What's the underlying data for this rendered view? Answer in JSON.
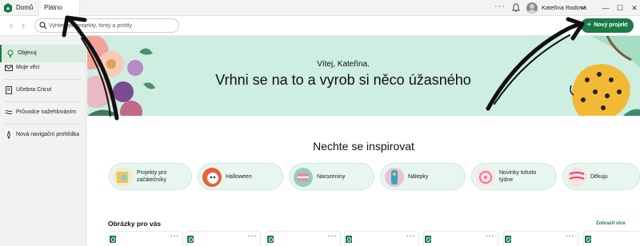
{
  "titlebar": {
    "tabs": [
      {
        "label": "Domů"
      },
      {
        "label": "Plátno"
      }
    ],
    "more_label": "···",
    "user_name": "Kateřina Rodová",
    "window_controls": {
      "minimize": "—",
      "maximize": "☐",
      "close": "✕"
    }
  },
  "toolbar": {
    "search_placeholder": "Vyhledejte projekty, fonty a profily",
    "new_project_label": "Nový projekt",
    "new_project_plus": "+"
  },
  "sidebar": {
    "items": [
      {
        "label": "Objevuj",
        "icon": "lightbulb-icon",
        "active": true
      },
      {
        "label": "Moje věci",
        "icon": "envelope-icon"
      },
      {
        "label": "Učebna Cricut",
        "icon": "notebook-icon"
      },
      {
        "label": "Průvodce nažehlováním",
        "icon": "heat-press-icon"
      },
      {
        "label": "Nová navigační prohlídka",
        "icon": "compass-icon"
      }
    ]
  },
  "hero": {
    "greeting": "Vítej, Kateřina.",
    "title": "Vrhni se na to a vyrob si něco úžasného"
  },
  "inspire": {
    "title": "Nechte se inspirovat",
    "chips": [
      {
        "label": "Projekty pro začátečníky"
      },
      {
        "label": "Halloween"
      },
      {
        "label": "Narozeniny"
      },
      {
        "label": "Nálepky"
      },
      {
        "label": "Novinky tohoto týdne"
      },
      {
        "label": "Děkuju"
      }
    ]
  },
  "for_you": {
    "title": "Obrázky pro vás",
    "show_more": "Zobrazit více"
  },
  "colors": {
    "brand_green": "#1b7a47",
    "hero_bg": "#cdeee1",
    "chip_bg": "#e7f6ef"
  }
}
